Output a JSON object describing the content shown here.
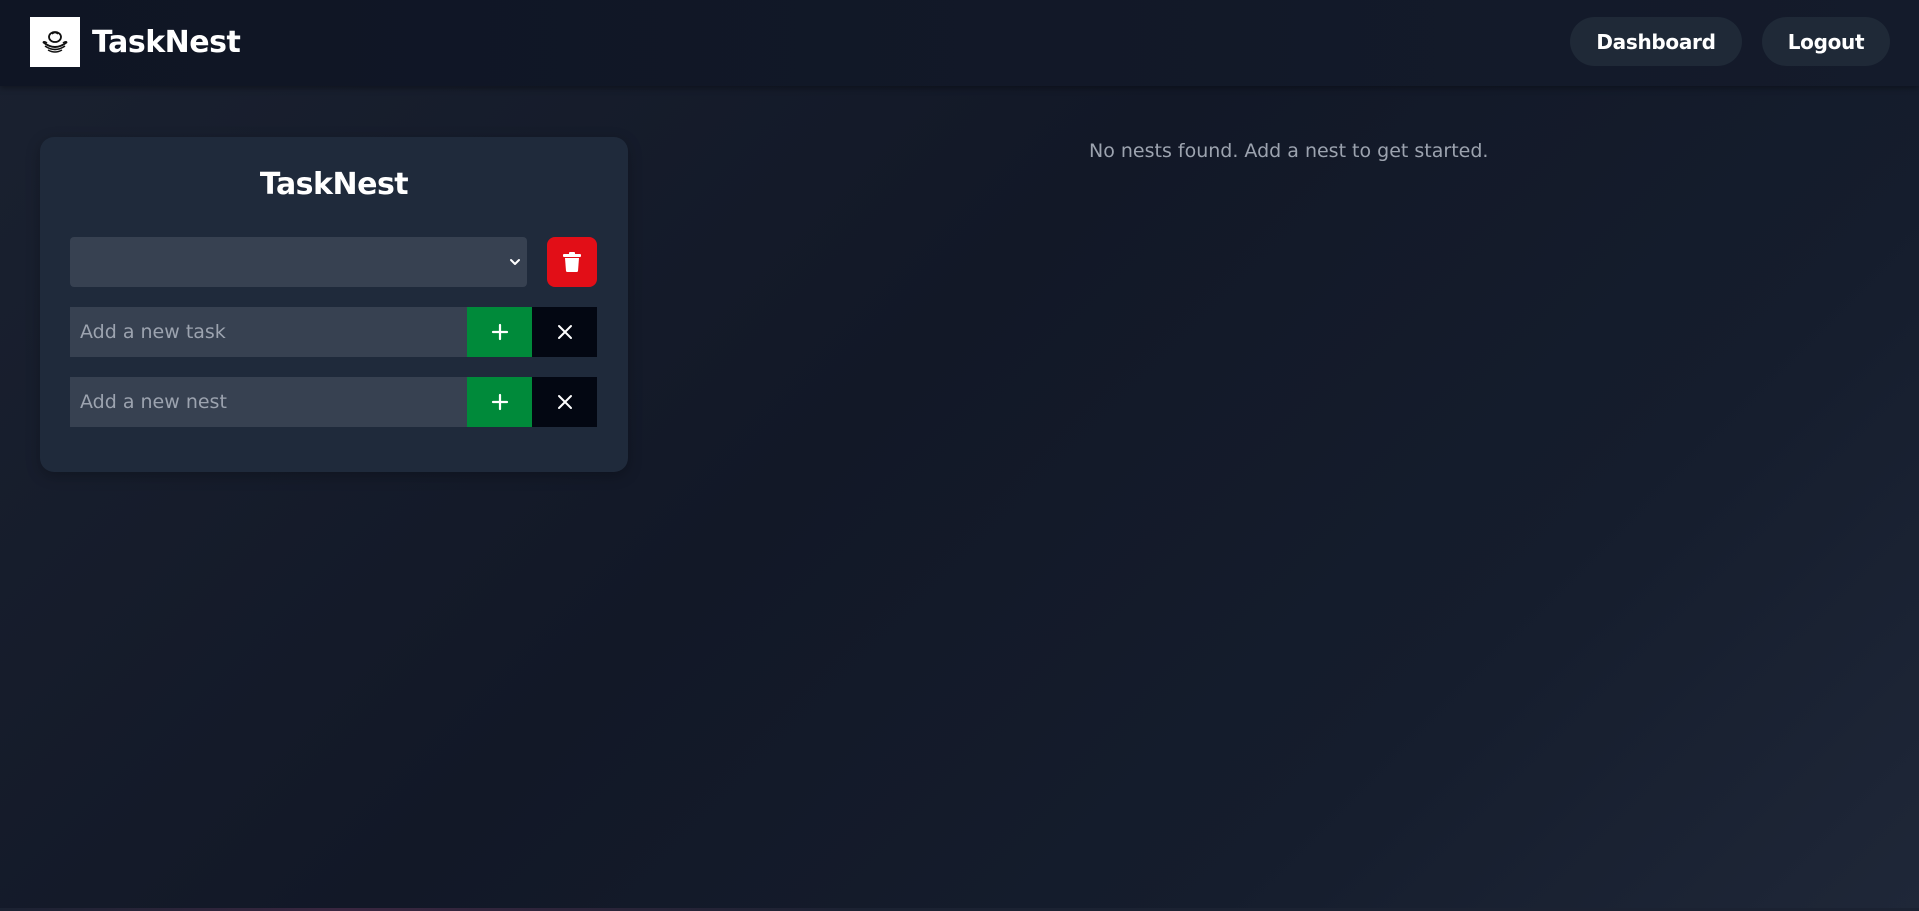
{
  "header": {
    "brand_name": "TaskNest",
    "logo_icon": "nest-egg-icon",
    "nav": {
      "dashboard_label": "Dashboard",
      "logout_label": "Logout"
    }
  },
  "panel": {
    "title": "TaskNest",
    "nest_select": {
      "selected_value": "",
      "icon": "chevron-down-icon"
    },
    "delete_button": {
      "icon": "trash-icon",
      "color": "#e20e17"
    },
    "task_input": {
      "value": "",
      "placeholder": "Add a new task",
      "add_icon": "plus-icon",
      "clear_icon": "close-icon"
    },
    "nest_input": {
      "value": "",
      "placeholder": "Add a new nest",
      "add_icon": "plus-icon",
      "clear_icon": "close-icon"
    }
  },
  "main": {
    "empty_message": "No nests found. Add a nest to get started."
  },
  "colors": {
    "add_green": "#008a3a",
    "clear_black": "#030712",
    "card_bg": "#1f2a3b",
    "input_bg": "#374151"
  }
}
